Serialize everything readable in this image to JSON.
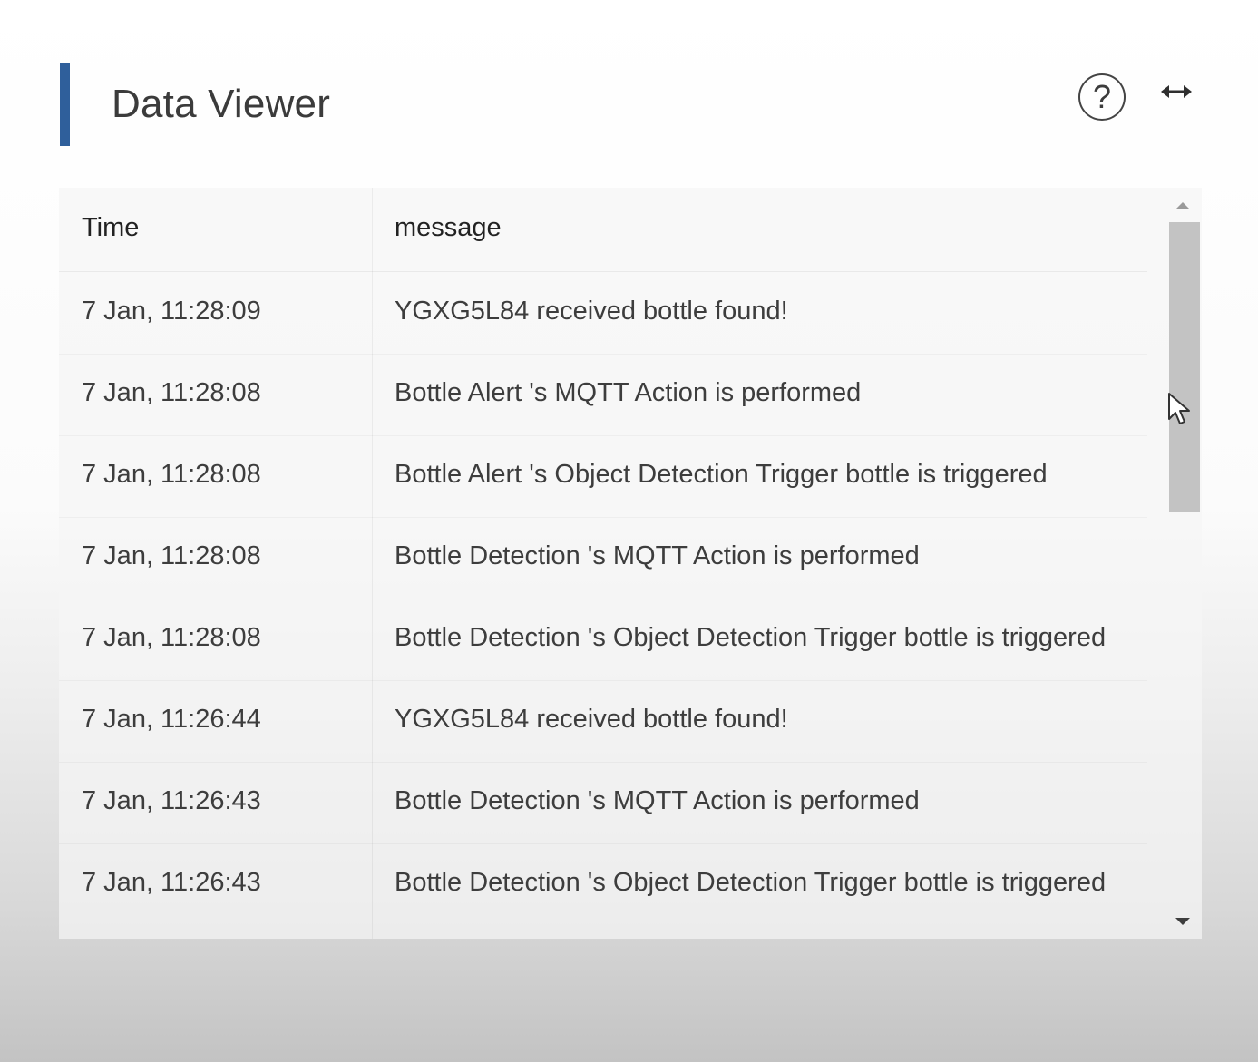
{
  "panel": {
    "title": "Data Viewer",
    "help_icon": "question-circle-icon",
    "help_glyph": "?",
    "expand_icon": "horizontal-expand-icon"
  },
  "table": {
    "columns": [
      "Time",
      "message"
    ],
    "rows": [
      {
        "time": "7 Jan, 11:28:09",
        "message": "YGXG5L84 received bottle found!"
      },
      {
        "time": "7 Jan, 11:28:08",
        "message": "Bottle Alert 's MQTT Action is performed"
      },
      {
        "time": "7 Jan, 11:28:08",
        "message": "Bottle Alert 's Object Detection Trigger bottle is triggered"
      },
      {
        "time": "7 Jan, 11:28:08",
        "message": "Bottle Detection 's MQTT Action is performed"
      },
      {
        "time": "7 Jan, 11:28:08",
        "message": "Bottle Detection 's Object Detection Trigger bottle is triggered"
      },
      {
        "time": "7 Jan, 11:26:44",
        "message": "YGXG5L84 received bottle found!"
      },
      {
        "time": "7 Jan, 11:26:43",
        "message": "Bottle Detection 's MQTT Action is performed"
      },
      {
        "time": "7 Jan, 11:26:43",
        "message": "Bottle Detection 's Object Detection Trigger bottle is triggered"
      }
    ]
  },
  "scrollbar": {
    "position_fraction": 0.0,
    "visible_fraction": 0.42
  },
  "colors": {
    "accent": "#2f5f9b",
    "text": "#3d3d3d",
    "scroll_thumb": "#c3c3c3"
  }
}
